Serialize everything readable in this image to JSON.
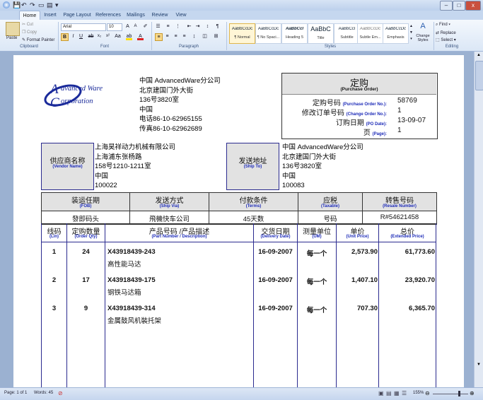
{
  "qat": {
    "icons": [
      "word-icon",
      "save-icon",
      "undo-icon",
      "redo-icon",
      "folder-icon",
      "print-icon"
    ]
  },
  "window_buttons": {
    "minimize": "–",
    "maximize": "□",
    "close": "x"
  },
  "tabs": [
    "Home",
    "Insert",
    "Page Layout",
    "References",
    "Mailings",
    "Review",
    "View"
  ],
  "ribbon": {
    "clipboard": {
      "paste": "Paste",
      "cut": "Cut",
      "copy": "Copy",
      "format_painter": "Format Painter",
      "label": "Clipboard"
    },
    "font": {
      "name": "Arial",
      "size": "10",
      "label": "Font"
    },
    "paragraph": {
      "label": "Paragraph"
    },
    "styles": {
      "items": [
        {
          "preview": "AaBbCcDc",
          "name": "¶ Normal"
        },
        {
          "preview": "AaBbCcDc",
          "name": "¶ No Spaci..."
        },
        {
          "preview": "AaBbCcI",
          "name": "Heading 5"
        },
        {
          "preview": "AaBbC",
          "name": "Title"
        },
        {
          "preview": "AaBbCcI",
          "name": "Subtitle"
        },
        {
          "preview": "AaBbCcDc",
          "name": "Subtle Em..."
        },
        {
          "preview": "AaBbCcDc",
          "name": "Emphasis"
        }
      ],
      "change_styles": "Change Styles",
      "label": "Styles"
    },
    "editing": {
      "find": "Find",
      "replace": "Replace",
      "select": "Select",
      "label": "Editing"
    }
  },
  "doc": {
    "logo": {
      "line1": "dvanced Ware",
      "line2": "orporation"
    },
    "company": [
      "中国 AdvancedWare分公司",
      "北京建国门外大街",
      "136号3820室",
      "中国",
      "电话86-10-62965155",
      "传真86-10-62962689"
    ],
    "po_box": {
      "title_cn": "定购",
      "title_en": "(Purchase Order)",
      "rows": [
        {
          "cn": "定购号码",
          "en": "(Purchase Order No.):",
          "value": "58769"
        },
        {
          "cn": "修改订单号码",
          "en": "(Change Order No.):",
          "value": "1"
        },
        {
          "cn": "订购日期",
          "en": "(PO Date):",
          "value": "13-09-07"
        },
        {
          "cn": "页",
          "en": "(Page):",
          "value": "1"
        }
      ]
    },
    "vendor": {
      "label_cn": "供应商名称",
      "label_en": "(Vendor Name)",
      "lines": [
        "上海昊祥动力机械有限公司",
        "上海浦东张杨路",
        "158号1210-1211室",
        "中国",
        "100022"
      ]
    },
    "shipto": {
      "label_cn": "发送地址",
      "label_en": "(Ship To)",
      "lines": [
        "中国 AdvancedWare分公司",
        "北京建国门外大街",
        "136号3820室",
        "中国",
        "100083"
      ]
    },
    "terms_headers": [
      {
        "cn": "装运任期",
        "en": "(FOB)"
      },
      {
        "cn": "发送方式",
        "en": "(Ship Via)"
      },
      {
        "cn": "付款条件",
        "en": "(Terms)"
      },
      {
        "cn": "应税",
        "en": "(Taxable)"
      },
      {
        "cn": "转售号码",
        "en": "(Resale Number)"
      }
    ],
    "terms_values": [
      "發即码头",
      "飛機快车公司",
      "45天数",
      "号码",
      "R#54621458"
    ],
    "item_headers": [
      {
        "cn": "线码",
        "en": "(Lin)"
      },
      {
        "cn": "定购数量",
        "en": "(Order Qty)"
      },
      {
        "cn": "产品号码  /产品描述",
        "en": "(Part Number / Description)"
      },
      {
        "cn": "交货日期",
        "en": "(Delivery Date)"
      },
      {
        "cn": "测量单位",
        "en": "(UM)"
      },
      {
        "cn": "单价",
        "en": "(Unit Price)"
      },
      {
        "cn": "总价",
        "en": "(Extended Price)"
      }
    ],
    "items": [
      {
        "line": "1",
        "qty": "24",
        "part": "X43918439-243",
        "desc": "高性能马达",
        "date": "16-09-2007",
        "um": "每一个",
        "unit": "2,573.90",
        "ext": "61,773.60"
      },
      {
        "line": "2",
        "qty": "17",
        "part": "X43918439-175",
        "desc": "钢铁马达箱",
        "date": "16-09-2007",
        "um": "每一个",
        "unit": "1,407.10",
        "ext": "23,920.70"
      },
      {
        "line": "3",
        "qty": "9",
        "part": "X43918439-314",
        "desc": "金属鼓风机裝托架",
        "date": "16-09-2007",
        "um": "每一个",
        "unit": "707.30",
        "ext": "6,365.70"
      }
    ]
  },
  "status": {
    "page": "Page: 1 of 1",
    "words": "Words: 45",
    "zoom": "155%"
  }
}
